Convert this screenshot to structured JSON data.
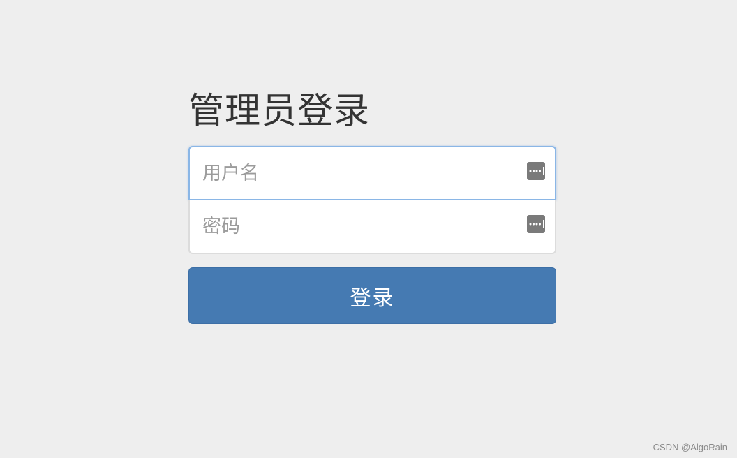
{
  "login": {
    "title": "管理员登录",
    "username": {
      "value": "",
      "placeholder": "用户名",
      "icon": "password-manager-key-icon"
    },
    "password": {
      "value": "",
      "placeholder": "密码",
      "icon": "password-manager-key-icon"
    },
    "submit_label": "登录"
  },
  "watermark": "CSDN @AlgoRain",
  "colors": {
    "background": "#eeeeee",
    "button": "#457ab2",
    "focus_border": "#8ab6e6",
    "title": "#333333"
  }
}
